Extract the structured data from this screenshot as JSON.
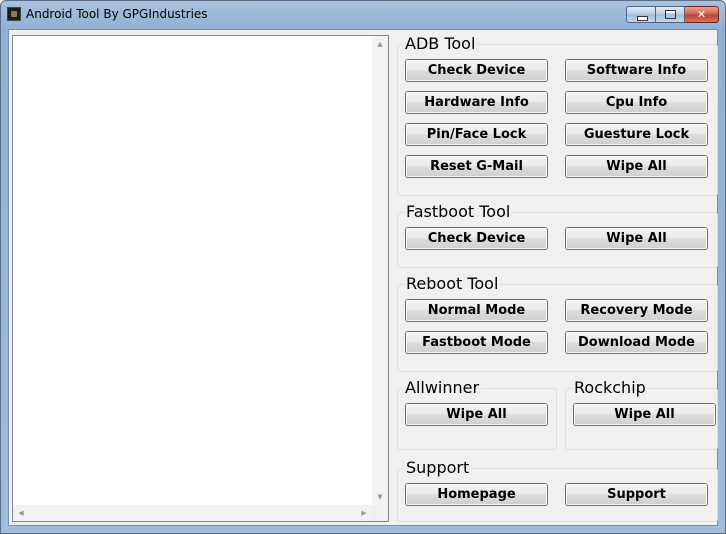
{
  "window": {
    "title": "Android Tool By GPGIndustries"
  },
  "adb": {
    "label": "ADB Tool",
    "buttons": [
      "Check Device",
      "Software Info",
      "Hardware Info",
      "Cpu Info",
      "Pin/Face Lock",
      "Guesture Lock",
      "Reset G-Mail",
      "Wipe All"
    ]
  },
  "fastboot": {
    "label": "Fastboot Tool",
    "buttons": [
      "Check Device",
      "Wipe All"
    ]
  },
  "reboot": {
    "label": "Reboot Tool",
    "buttons": [
      "Normal Mode",
      "Recovery Mode",
      "Fastboot Mode",
      "Download Mode"
    ]
  },
  "allwinner": {
    "label": "Allwinner",
    "button": "Wipe All"
  },
  "rockchip": {
    "label": "Rockchip",
    "button": "Wipe All"
  },
  "support": {
    "label": "Support",
    "buttons": [
      "Homepage",
      "Support"
    ]
  },
  "log": {
    "text": ""
  }
}
